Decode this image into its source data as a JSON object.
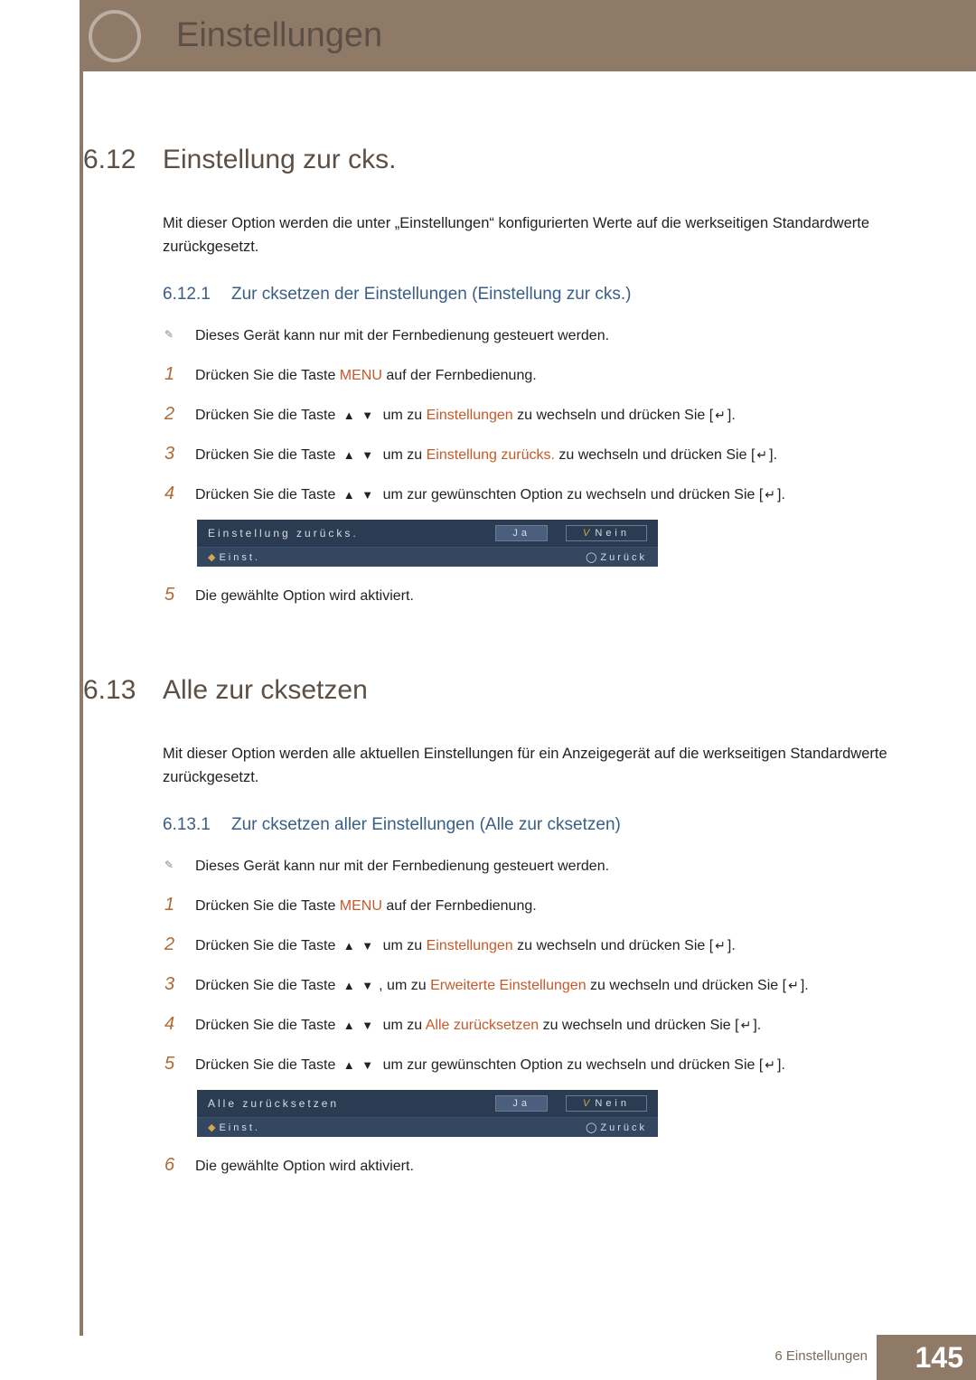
{
  "chapter": {
    "number": "6",
    "title": "Einstellungen"
  },
  "sections": [
    {
      "number": "6.12",
      "title": "Einstellung zur cks.",
      "intro": "Mit dieser Option werden die unter „Einstellungen“ konfigurierten Werte auf die werkseitigen Standardwerte zurückgesetzt.",
      "sub": {
        "number": "6.12.1",
        "title": "Zur cksetzen der Einstellungen (Einstellung zur cks.)"
      },
      "note": "Dieses Gerät kann nur mit der Fernbedienung gesteuert werden.",
      "steps": {
        "s1_pre": "Drücken Sie die Taste ",
        "s1_menu": "MENU",
        "s1_post": " auf der Fernbedienung.",
        "s2_pre": "Drücken Sie die Taste ",
        "s2_mid": " um zu ",
        "s2_hl": "Einstellungen",
        "s2_post": " zu wechseln und drücken Sie [",
        "s2_end": "].",
        "s3_pre": "Drücken Sie die Taste ",
        "s3_mid": " um zu ",
        "s3_hl": "Einstellung zurücks.",
        "s3_post": " zu wechseln und drücken Sie [",
        "s3_end": "].",
        "s4_pre": "Drücken Sie die Taste ",
        "s4_mid": " um zur gewünschten Option zu wechseln und drücken Sie [",
        "s4_end": "].",
        "s5": "Die gewählte Option wird aktiviert."
      },
      "osd": {
        "title": "Einstellung zurücks.",
        "ja": "Ja",
        "nein": "Nein",
        "einst": "Einst.",
        "zuruck": "Zurück"
      }
    },
    {
      "number": "6.13",
      "title": "Alle zur cksetzen",
      "intro": "Mit dieser Option werden alle aktuellen Einstellungen für ein Anzeigegerät auf die werkseitigen Standardwerte zurückgesetzt.",
      "sub": {
        "number": "6.13.1",
        "title": "Zur cksetzen aller Einstellungen (Alle zur cksetzen)"
      },
      "note": "Dieses Gerät kann nur mit der Fernbedienung gesteuert werden.",
      "steps": {
        "s1_pre": "Drücken Sie die Taste ",
        "s1_menu": "MENU",
        "s1_post": " auf der Fernbedienung.",
        "s2_pre": "Drücken Sie die Taste ",
        "s2_mid": " um zu ",
        "s2_hl": "Einstellungen",
        "s2_post": " zu wechseln und drücken Sie [",
        "s2_end": "].",
        "s3_pre": "Drücken Sie die Taste ",
        "s3_mid": ", um zu ",
        "s3_hl": "Erweiterte Einstellungen",
        "s3_post": " zu wechseln und drücken Sie [",
        "s3_end": "].",
        "s4_pre": "Drücken Sie die Taste ",
        "s4_mid": " um zu ",
        "s4_hl": "Alle zurücksetzen",
        "s4_post": " zu wechseln und drücken Sie [",
        "s4_end": "].",
        "s5_pre": "Drücken Sie die Taste ",
        "s5_mid": " um zur gewünschten Option zu wechseln und drücken Sie [",
        "s5_end": "].",
        "s6": "Die gewählte Option wird aktiviert."
      },
      "osd": {
        "title": "Alle zurücksetzen",
        "ja": "Ja",
        "nein": "Nein",
        "einst": "Einst.",
        "zuruck": "Zurück"
      }
    }
  ],
  "footer": {
    "chapter_label": "6 Einstellungen",
    "page": "145"
  },
  "glyphs": {
    "up_down": "▲ ▼",
    "enter": "↵"
  }
}
